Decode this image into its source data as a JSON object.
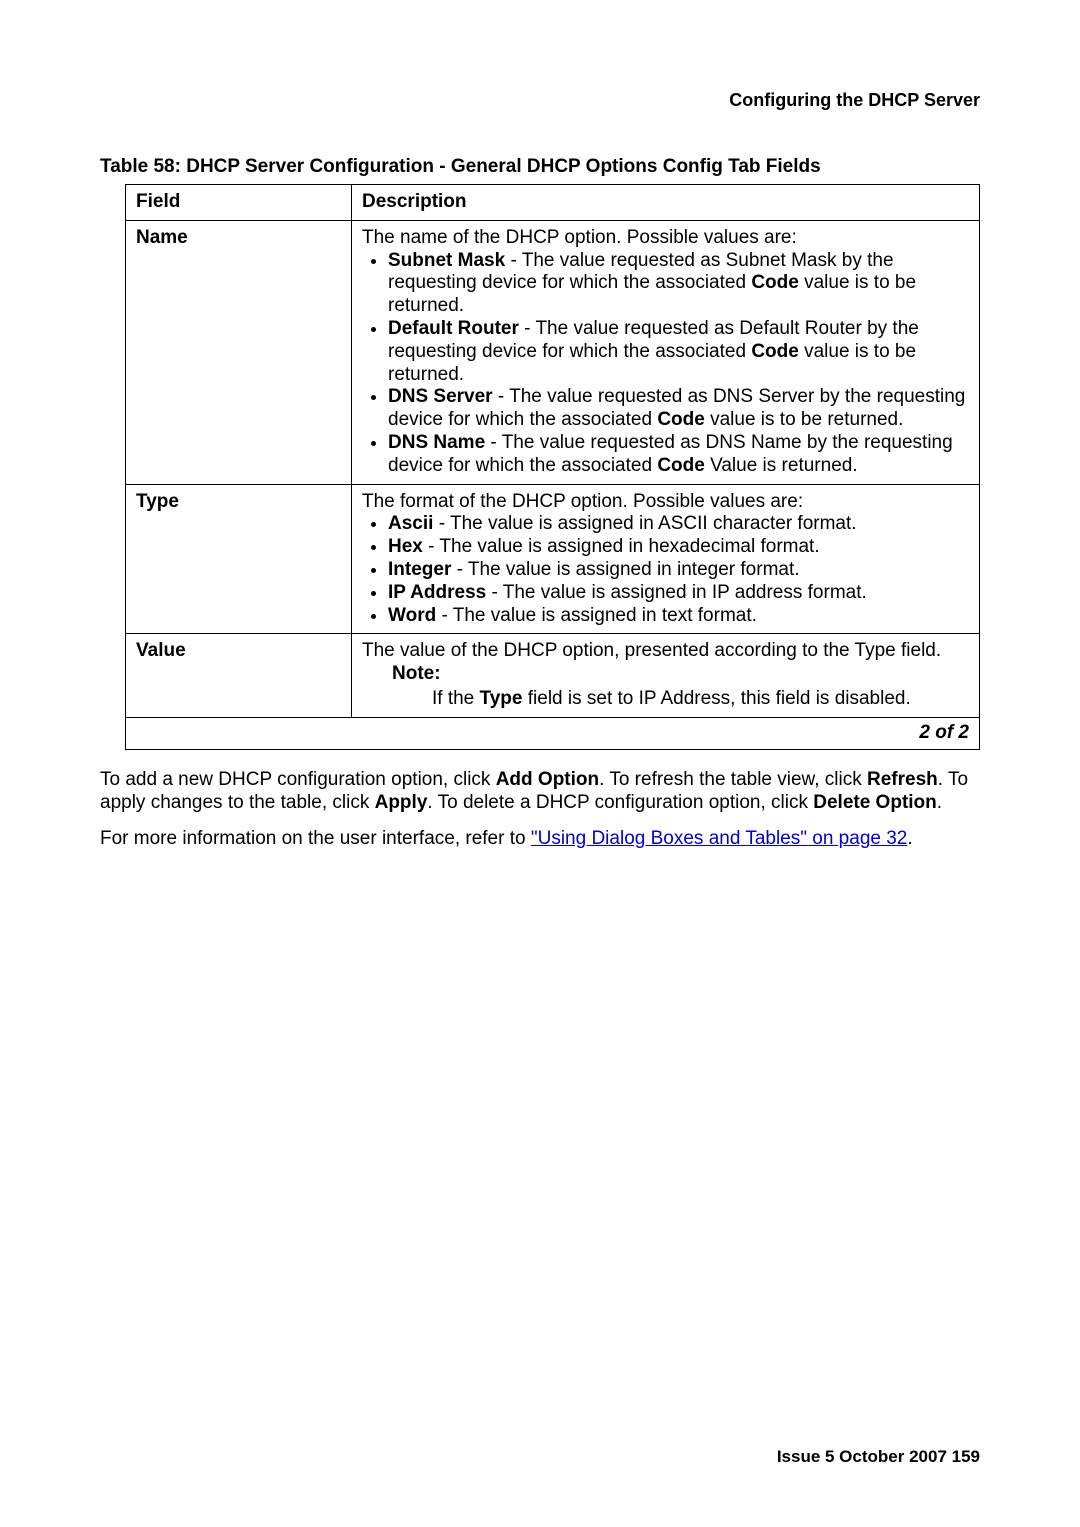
{
  "header": {
    "section_title": "Configuring the DHCP Server"
  },
  "table": {
    "caption": "Table 58: DHCP Server Configuration - General DHCP Options Config Tab Fields",
    "head": {
      "field": "Field",
      "desc": "Description"
    },
    "rows": [
      {
        "field": "Name",
        "intro": "The name of the DHCP option. Possible values are:",
        "items": [
          {
            "strong": "Subnet Mask",
            "rest": " - The value requested as Subnet Mask by the requesting device for which the associated ",
            "code": "Code",
            "tail": " value is to be returned."
          },
          {
            "strong": "Default Router",
            "rest": " - The value requested as Default Router by the requesting device for which the associated ",
            "code": "Code",
            "tail": " value is to be returned."
          },
          {
            "strong": "DNS Server",
            "rest": " - The value requested as DNS Server by the requesting device for which the associated ",
            "code": "Code",
            "tail": " value is to be returned."
          },
          {
            "strong": "DNS Name",
            "rest": " - The value requested as DNS Name by the requesting device for which the associated ",
            "code": "Code",
            "tail": " Value is returned."
          }
        ]
      },
      {
        "field": "Type",
        "intro": "The format of the DHCP option. Possible values are:",
        "items": [
          {
            "strong": "Ascii",
            "rest": " - The value is assigned in ASCII character format."
          },
          {
            "strong": "Hex",
            "rest": " - The value is assigned in hexadecimal format."
          },
          {
            "strong": "Integer",
            "rest": " - The value is assigned in integer format."
          },
          {
            "strong": "IP Address",
            "rest": " - The value is assigned in IP address format."
          },
          {
            "strong": "Word",
            "rest": " - The value is assigned in text format."
          }
        ]
      },
      {
        "field": "Value",
        "intro": "The value of the DHCP option, presented according to the Type field.",
        "note_label": "Note:",
        "note_pre": "If the ",
        "note_strong": "Type",
        "note_post": " field is set to IP Address, this field is disabled."
      }
    ],
    "pager": "2 of 2"
  },
  "body": {
    "p1_a": "To add a new DHCP configuration option, click ",
    "p1_b": "Add Option",
    "p1_c": ". To refresh the table view, click ",
    "p1_d": "Refresh",
    "p1_e": ". To apply changes to the table, click ",
    "p1_f": "Apply",
    "p1_g": ". To delete a DHCP configuration option, click ",
    "p1_h": "Delete Option",
    "p1_i": ".",
    "p2_a": "For more information on the user interface, refer to ",
    "p2_link": "\"Using Dialog Boxes and Tables\" on page 32",
    "p2_b": "."
  },
  "footer": {
    "text": "Issue 5   October 2007    159"
  }
}
